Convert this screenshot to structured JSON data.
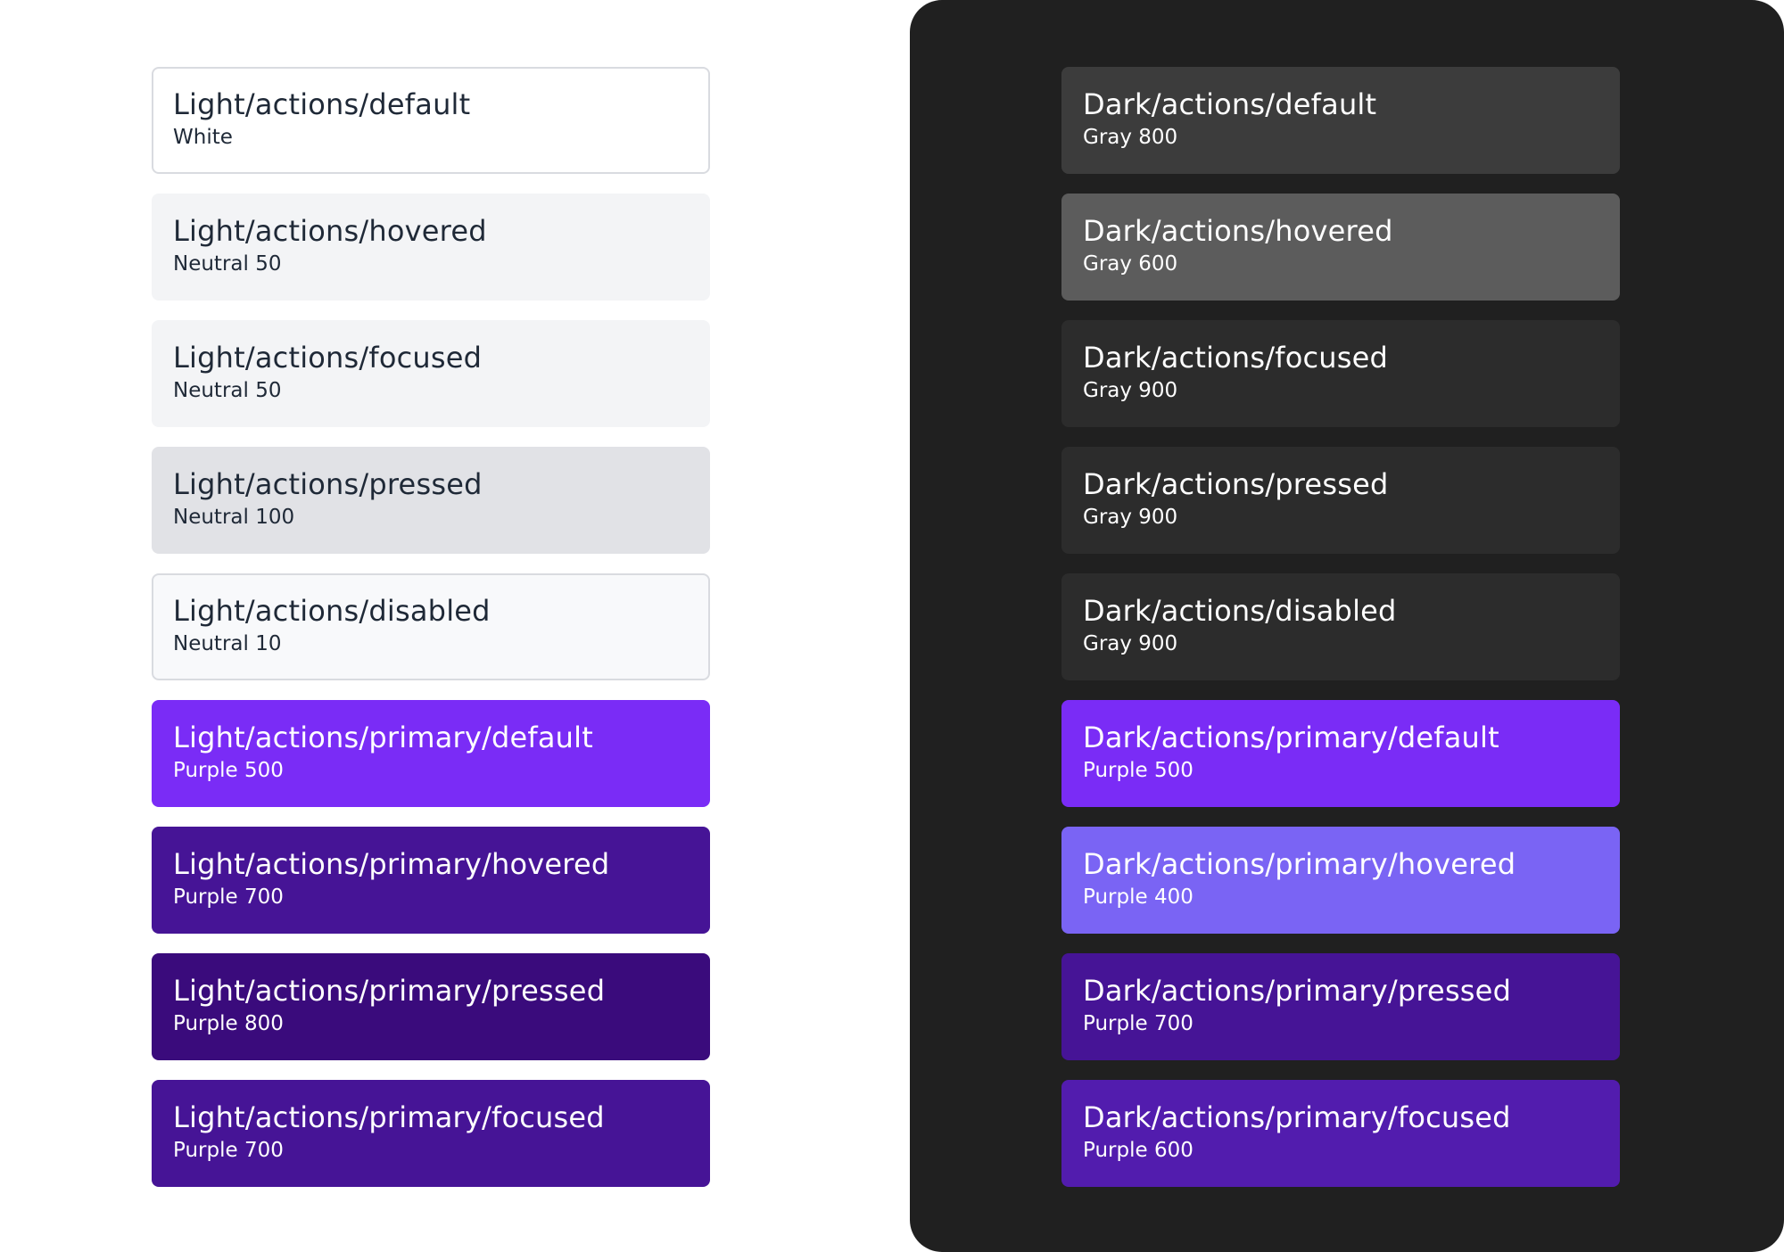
{
  "light": {
    "swatches": [
      {
        "title": "Light/actions/default",
        "color_name": "White",
        "bg": "#ffffff",
        "fg": "#1f2937",
        "border": "#d9dbe0"
      },
      {
        "title": "Light/actions/hovered",
        "color_name": "Neutral 50",
        "bg": "#f3f4f6",
        "fg": "#1f2937"
      },
      {
        "title": "Light/actions/focused",
        "color_name": "Neutral 50",
        "bg": "#f3f4f6",
        "fg": "#1f2937"
      },
      {
        "title": "Light/actions/pressed",
        "color_name": "Neutral 100",
        "bg": "#e1e2e6",
        "fg": "#1f2937"
      },
      {
        "title": "Light/actions/disabled",
        "color_name": "Neutral 10",
        "bg": "#f8f9fb",
        "fg": "#1f2937",
        "border": "#d9dbe0"
      },
      {
        "title": "Light/actions/primary/default",
        "color_name": "Purple 500",
        "bg": "#7a2cf6",
        "fg": "#ffffff"
      },
      {
        "title": "Light/actions/primary/hovered",
        "color_name": "Purple 700",
        "bg": "#461496",
        "fg": "#ffffff"
      },
      {
        "title": "Light/actions/primary/pressed",
        "color_name": "Purple 800",
        "bg": "#3a0b7c",
        "fg": "#ffffff"
      },
      {
        "title": "Light/actions/primary/focused",
        "color_name": "Purple 700",
        "bg": "#461496",
        "fg": "#ffffff"
      }
    ]
  },
  "dark": {
    "swatches": [
      {
        "title": "Dark/actions/default",
        "color_name": "Gray 800",
        "bg": "#3c3c3c",
        "fg": "#ffffff"
      },
      {
        "title": "Dark/actions/hovered",
        "color_name": "Gray 600",
        "bg": "#5c5c5c",
        "fg": "#ffffff"
      },
      {
        "title": "Dark/actions/focused",
        "color_name": "Gray 900",
        "bg": "#2c2c2c",
        "fg": "#ffffff"
      },
      {
        "title": "Dark/actions/pressed",
        "color_name": "Gray 900",
        "bg": "#2c2c2c",
        "fg": "#ffffff"
      },
      {
        "title": "Dark/actions/disabled",
        "color_name": "Gray 900",
        "bg": "#2c2c2c",
        "fg": "#ffffff"
      },
      {
        "title": "Dark/actions/primary/default",
        "color_name": "Purple 500",
        "bg": "#7a2cf6",
        "fg": "#ffffff"
      },
      {
        "title": "Dark/actions/primary/hovered",
        "color_name": "Purple 400",
        "bg": "#7a64f4",
        "fg": "#ffffff"
      },
      {
        "title": "Dark/actions/primary/pressed",
        "color_name": "Purple 700",
        "bg": "#461496",
        "fg": "#ffffff"
      },
      {
        "title": "Dark/actions/primary/focused",
        "color_name": "Purple 600",
        "bg": "#521cae",
        "fg": "#ffffff"
      }
    ]
  },
  "colors": {
    "page_bg": "#ffffff",
    "dark_panel_bg": "#202020"
  }
}
